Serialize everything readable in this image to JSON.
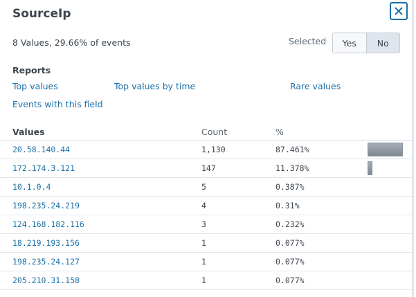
{
  "title": "SourceIp",
  "summary": "8 Values, 29.66% of events",
  "selected": {
    "label": "Selected",
    "yes": "Yes",
    "no": "No",
    "active": "No"
  },
  "reports": {
    "heading": "Reports",
    "links": [
      "Top values",
      "Top values by time",
      "Rare values",
      "Events with this field"
    ]
  },
  "table": {
    "headers": [
      "Values",
      "Count",
      "%"
    ],
    "rows": [
      {
        "value": "20.58.140.44",
        "count": "1,130",
        "percent": "87.461%",
        "fraction": 0.87461
      },
      {
        "value": "172.174.3.121",
        "count": "147",
        "percent": "11.378%",
        "fraction": 0.11378
      },
      {
        "value": "10.1.0.4",
        "count": "5",
        "percent": "0.387%",
        "fraction": 0.00387
      },
      {
        "value": "198.235.24.219",
        "count": "4",
        "percent": "0.31%",
        "fraction": 0.0031
      },
      {
        "value": "124.168.182.116",
        "count": "3",
        "percent": "0.232%",
        "fraction": 0.00232
      },
      {
        "value": "18.219.193.156",
        "count": "1",
        "percent": "0.077%",
        "fraction": 0.00077
      },
      {
        "value": "198.235.24.127",
        "count": "1",
        "percent": "0.077%",
        "fraction": 0.00077
      },
      {
        "value": "205.210.31.158",
        "count": "1",
        "percent": "0.077%",
        "fraction": 0.00077
      }
    ]
  },
  "colors": {
    "link": "#1a6fa8",
    "bar": "#8a939e",
    "text": "#3c444d"
  },
  "icons": {
    "close": "close-icon"
  }
}
